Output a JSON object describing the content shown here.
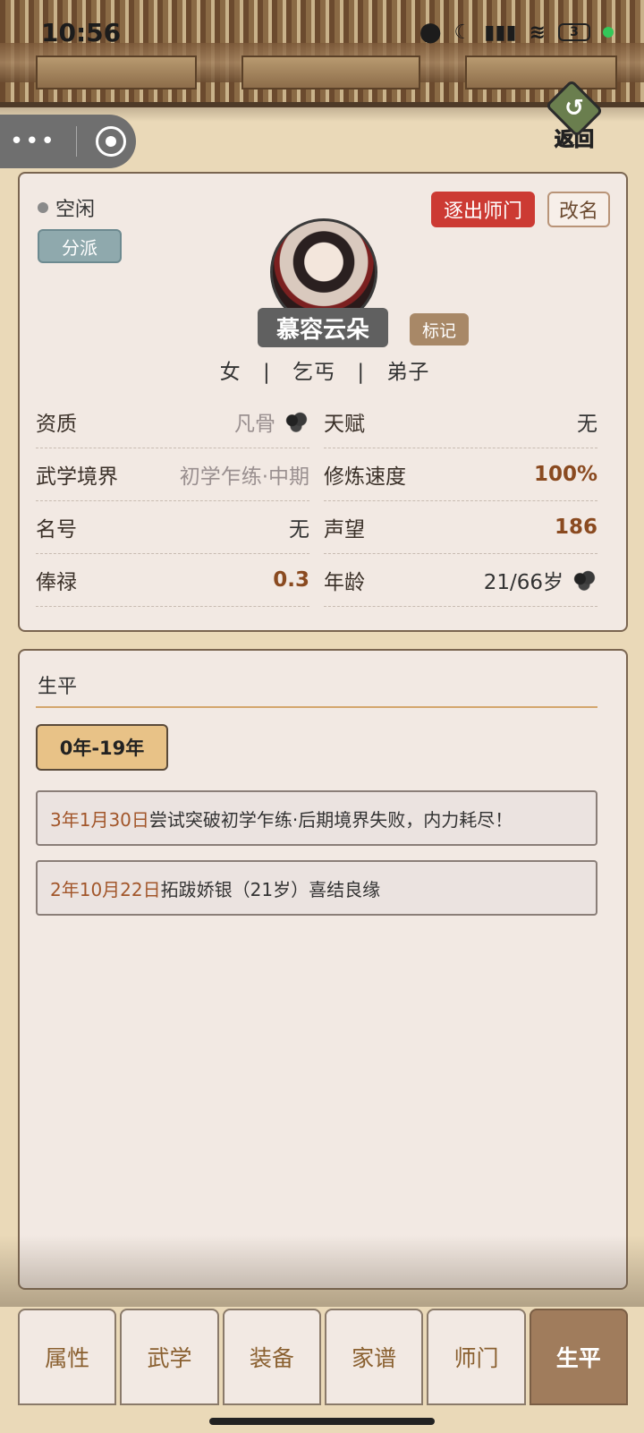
{
  "status_bar": {
    "time": "10:56",
    "battery": "3"
  },
  "header": {
    "back_label": "返回"
  },
  "profile": {
    "status_text": "空闲",
    "faction_button": "分派",
    "expel_button": "逐出师门",
    "rename_button": "改名",
    "name": "慕容云朵",
    "mark_button": "标记",
    "gender": "女",
    "origin": "乞丐",
    "rank": "弟子",
    "separator": "|",
    "stats": [
      {
        "label": "资质",
        "value": "凡骨"
      },
      {
        "label": "天赋",
        "value": "无"
      },
      {
        "label": "武学境界",
        "value": "初学乍练·中期"
      },
      {
        "label": "修炼速度",
        "value": "100%"
      },
      {
        "label": "名号",
        "value": "无"
      },
      {
        "label": "声望",
        "value": "186"
      },
      {
        "label": "俸禄",
        "value": "0.3"
      },
      {
        "label": "年龄",
        "value": "21/66岁"
      }
    ]
  },
  "biography": {
    "title": "生平",
    "period_button": "0年-19年",
    "events": [
      {
        "date": "3年1月30日",
        "text": "尝试突破初学乍练·后期境界失败，内力耗尽！"
      },
      {
        "date": "2年10月22日",
        "text": "拓跋娇银（21岁）喜结良缘"
      }
    ]
  },
  "tabs": [
    {
      "label": "属性"
    },
    {
      "label": "武学"
    },
    {
      "label": "装备"
    },
    {
      "label": "家谱"
    },
    {
      "label": "师门"
    },
    {
      "label": "生平"
    }
  ],
  "active_tab": "生平",
  "colors": {
    "expel": "#cc3a33",
    "accent_value": "#8a4a20",
    "event_date": "#a2562a",
    "active_tab": "#a07c5c"
  }
}
